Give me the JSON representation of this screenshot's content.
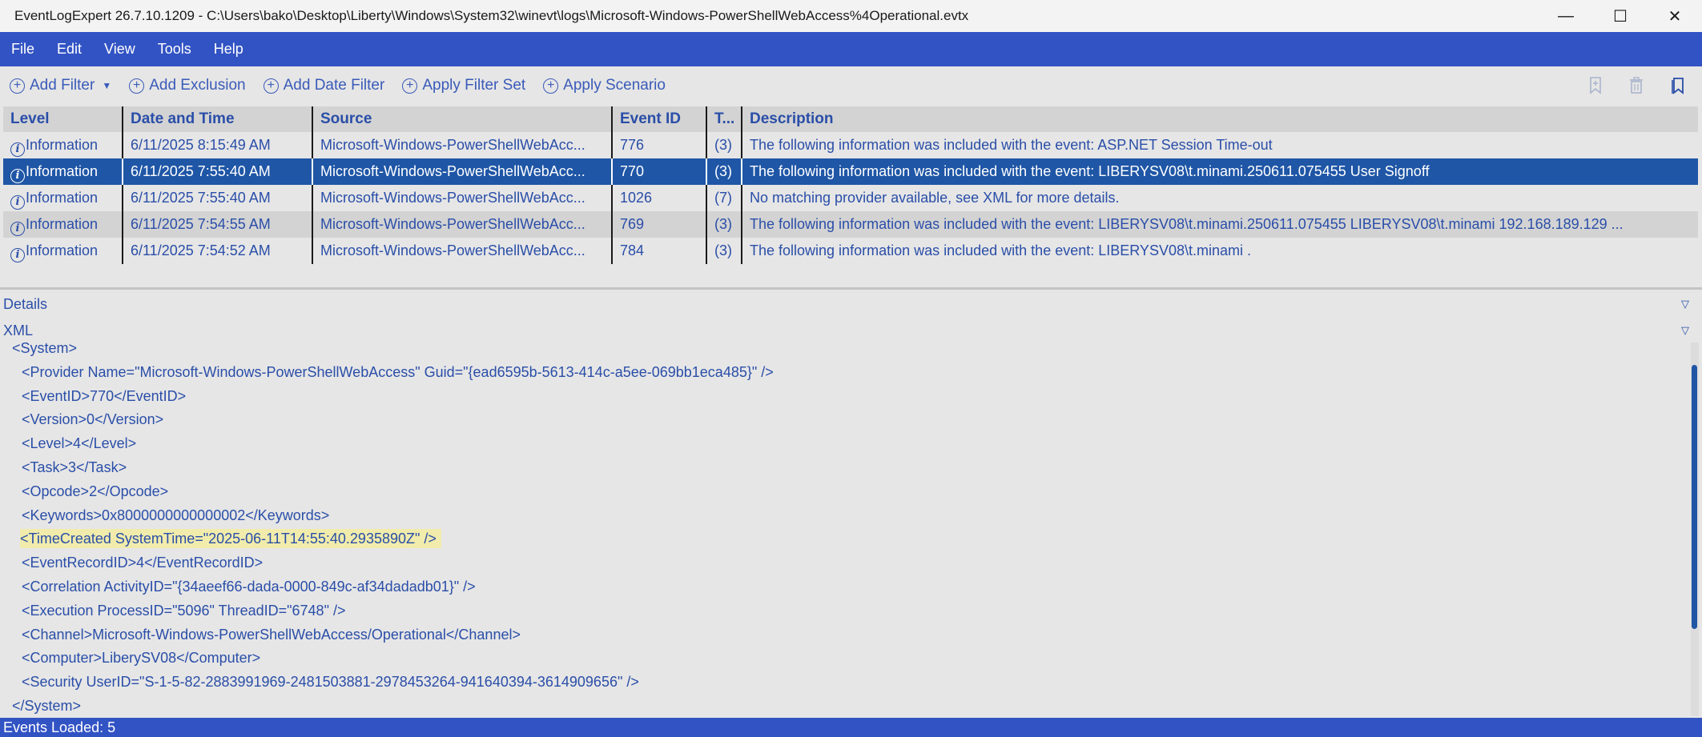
{
  "window": {
    "title": "EventLogExpert 26.7.10.1209 - C:\\Users\\bako\\Desktop\\Liberty\\Windows\\System32\\winevt\\logs\\Microsoft-Windows-PowerShellWebAccess%4Operational.evtx",
    "minimize": "—",
    "maximize": "☐",
    "close": "✕"
  },
  "menu": {
    "items": [
      "File",
      "Edit",
      "View",
      "Tools",
      "Help"
    ]
  },
  "toolbar": {
    "plus_glyph": "+",
    "dropdown_glyph": "▼",
    "items": [
      "Add Filter",
      "Add Exclusion",
      "Add Date Filter",
      "Apply Filter Set",
      "Apply Scenario"
    ]
  },
  "grid": {
    "columns": [
      "Level",
      "Date and Time",
      "Source",
      "Event ID",
      "T...",
      "Description"
    ],
    "info_glyph": "i",
    "selected_row": 1,
    "rows": [
      {
        "level": "Information",
        "date": "6/11/2025 8:15:49 AM",
        "source": "Microsoft-Windows-PowerShellWebAcc...",
        "event_id": "776",
        "task": "(3)",
        "description": "The following information was included with the event: ASP.NET Session Time-out"
      },
      {
        "level": "Information",
        "date": "6/11/2025 7:55:40 AM",
        "source": "Microsoft-Windows-PowerShellWebAcc...",
        "event_id": "770",
        "task": "(3)",
        "description": "The following information was included with the event: LIBERYSV08\\t.minami.250611.075455 User Signoff"
      },
      {
        "level": "Information",
        "date": "6/11/2025 7:55:40 AM",
        "source": "Microsoft-Windows-PowerShellWebAcc...",
        "event_id": "1026",
        "task": "(7)",
        "description": "No matching provider available, see XML for more details."
      },
      {
        "level": "Information",
        "date": "6/11/2025 7:54:55 AM",
        "source": "Microsoft-Windows-PowerShellWebAcc...",
        "event_id": "769",
        "task": "(3)",
        "description": "The following information was included with the event: LIBERYSV08\\t.minami.250611.075455 LIBERYSV08\\t.minami 192.168.189.129 ..."
      },
      {
        "level": "Information",
        "date": "6/11/2025 7:54:52 AM",
        "source": "Microsoft-Windows-PowerShellWebAcc...",
        "event_id": "784",
        "task": "(3)",
        "description": "The following information was included with the event: LIBERYSV08\\t.minami ."
      }
    ]
  },
  "details": {
    "label": "Details",
    "xml_label": "XML",
    "collapse_glyph": "▽",
    "xml_lines": [
      "<System>",
      "<Provider Name=\"Microsoft-Windows-PowerShellWebAccess\" Guid=\"{ead6595b-5613-414c-a5ee-069bb1eca485}\" />",
      "<EventID>770</EventID>",
      "<Version>0</Version>",
      "<Level>4</Level>",
      "<Task>3</Task>",
      "<Opcode>2</Opcode>",
      "<Keywords>0x8000000000000002</Keywords>",
      "<TimeCreated SystemTime=\"2025-06-11T14:55:40.2935890Z\" />",
      "<EventRecordID>4</EventRecordID>",
      "<Correlation ActivityID=\"{34aeef66-dada-0000-849c-af34dadadb01}\" />",
      "<Execution ProcessID=\"5096\" ThreadID=\"6748\" />",
      "<Channel>Microsoft-Windows-PowerShellWebAccess/Operational</Channel>",
      "<Computer>LiberySV08</Computer>",
      "<Security UserID=\"S-1-5-82-2883991969-2481503881-2978453264-941640394-3614909656\" />",
      "</System>"
    ],
    "highlight_line": 8
  },
  "status": {
    "text": "Events Loaded: 5"
  },
  "colors": {
    "accent": "#3253c4",
    "selection": "#1f56a6",
    "text_blue": "#2a4ea8",
    "highlight": "#f1ecab"
  }
}
